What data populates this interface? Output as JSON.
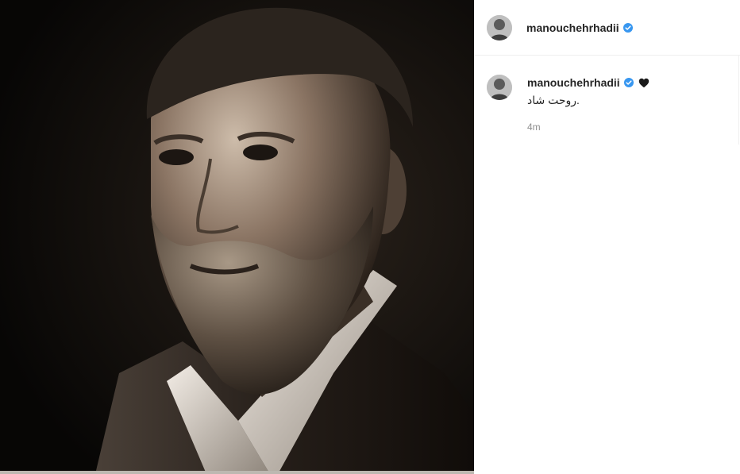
{
  "post": {
    "image_description_icon": "portrait-photo",
    "author": {
      "username": "manouchehrhadii",
      "verified": true
    },
    "caption": {
      "username": "manouchehrhadii",
      "emoji": "black-heart-icon",
      "text": "روحت شاد.",
      "time": "4m"
    }
  },
  "colors": {
    "verified_badge": "#3897f0",
    "muted_text": "#8e8e8e",
    "border": "#efefef"
  }
}
